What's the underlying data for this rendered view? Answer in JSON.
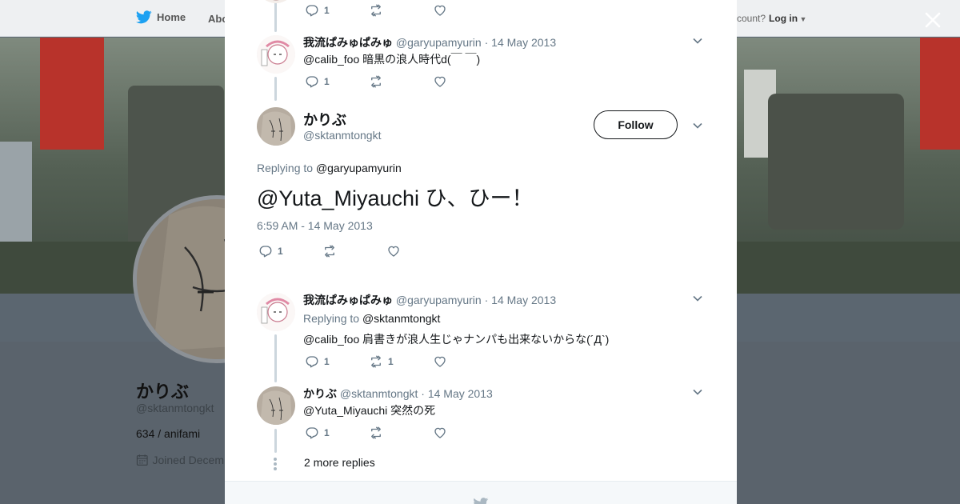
{
  "topnav": {
    "home_label": "Home",
    "about_label": "Abo",
    "account_text": "ccount?",
    "login_label": "Log in"
  },
  "profile": {
    "name": "かりぶ",
    "handle": "@sktanmtongkt",
    "bio": "634 / anifami",
    "joined": "Joined Decem"
  },
  "modal": {
    "tweets_before": [
      {
        "reply_count": "1"
      },
      {
        "name": "我流ぱみゅぱみゅ",
        "handle": "@garyupamyurin",
        "sep": "·",
        "date": "14 May 2013",
        "text": "@calib_foo 暗黒の浪人時代d(￣ ￣)",
        "reply_count": "1"
      }
    ],
    "focused": {
      "name": "かりぶ",
      "handle": "@sktanmtongkt",
      "follow_label": "Follow",
      "replying_prefix": "Replying to",
      "replying_to": "@garyupamyurin",
      "text": "@Yuta_Miyauchi ひ、ひー！",
      "timestamp": "6:59 AM - 14 May 2013",
      "reply_count": "1"
    },
    "replies": [
      {
        "name": "我流ぱみゅぱみゅ",
        "handle": "@garyupamyurin",
        "sep": "·",
        "date": "14 May 2013",
        "replying_prefix": "Replying to",
        "replying_to": "@sktanmtongkt",
        "text": "@calib_foo 肩書きが浪人生じゃナンパも出来ないからな(´Д`)",
        "reply_count": "1",
        "retweet_count": "1"
      },
      {
        "name": "かりぶ",
        "handle": "@sktanmtongkt",
        "sep": "·",
        "date": "14 May 2013",
        "text": "@Yuta_Miyauchi 突然の死",
        "reply_count": "1"
      }
    ],
    "more_replies_label": "2 more replies"
  },
  "colors": {
    "accent": "#1da1f2",
    "muted": "#657786",
    "text": "#14171a",
    "line": "#ccd6dd"
  },
  "icons": {
    "reply": "reply-icon",
    "retweet": "retweet-icon",
    "like": "heart-icon",
    "caret": "chevron-down-icon",
    "close": "close-icon",
    "brand": "twitter-bird-icon",
    "calendar": "calendar-icon"
  }
}
